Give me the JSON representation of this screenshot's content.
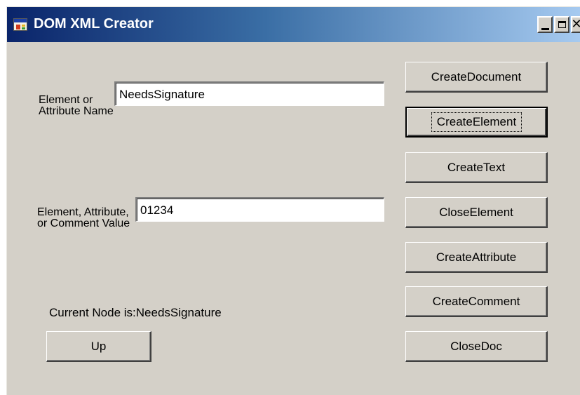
{
  "window": {
    "title": "DOM XML Creator",
    "controls": {
      "minimize": "_",
      "maximize": "□",
      "close": "X"
    }
  },
  "form": {
    "name_label": "Element or Attribute Name",
    "name_value": "NeedsSignature",
    "value_label": "Element, Attribute, or Comment Value",
    "value_value": "01234",
    "current_node_text": "Current Node is:NeedsSignature"
  },
  "buttons": {
    "create_document": "CreateDocument",
    "create_element": "CreateElement",
    "create_text": "CreateText",
    "close_element": "CloseElement",
    "create_attribute": "CreateAttribute",
    "create_comment": "CreateComment",
    "close_doc": "CloseDoc",
    "up": "Up"
  },
  "focused_button": "CreateElement",
  "colors": {
    "window_face": "#d4d0c8",
    "title_gradient_start": "#0a246a",
    "title_gradient_end": "#a6caf0",
    "title_text": "#ffffff"
  }
}
